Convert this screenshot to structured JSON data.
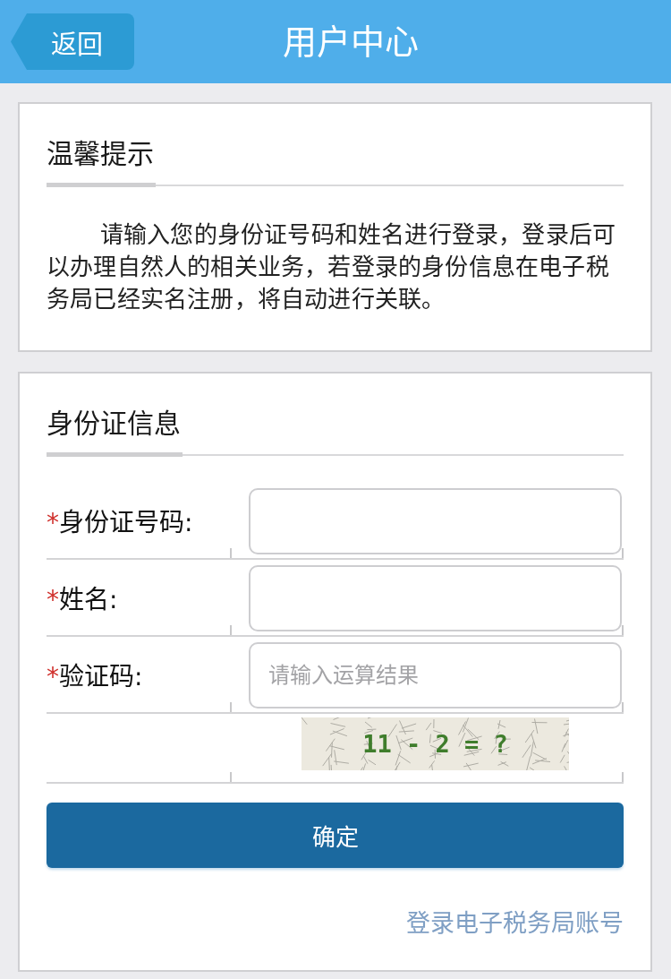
{
  "header": {
    "back_button": "返回",
    "title": "用户中心"
  },
  "notice": {
    "heading": "温馨提示",
    "text": "请输入您的身份证号码和姓名进行登录，登录后可以办理自然人的相关业务，若登录的身份信息在电子税务局已经实名注册，将自动进行关联。"
  },
  "id_form": {
    "heading": "身份证信息",
    "fields": [
      {
        "required_mark": "*",
        "label": "身份证号码:"
      },
      {
        "required_mark": "*",
        "label": "姓名:"
      },
      {
        "required_mark": "*",
        "label": "验证码:",
        "placeholder": "请输入运算结果"
      }
    ],
    "captcha": {
      "text": "11 - 2 = ?"
    },
    "submit_button": "确定",
    "link": "登录电子税务局账号"
  }
}
